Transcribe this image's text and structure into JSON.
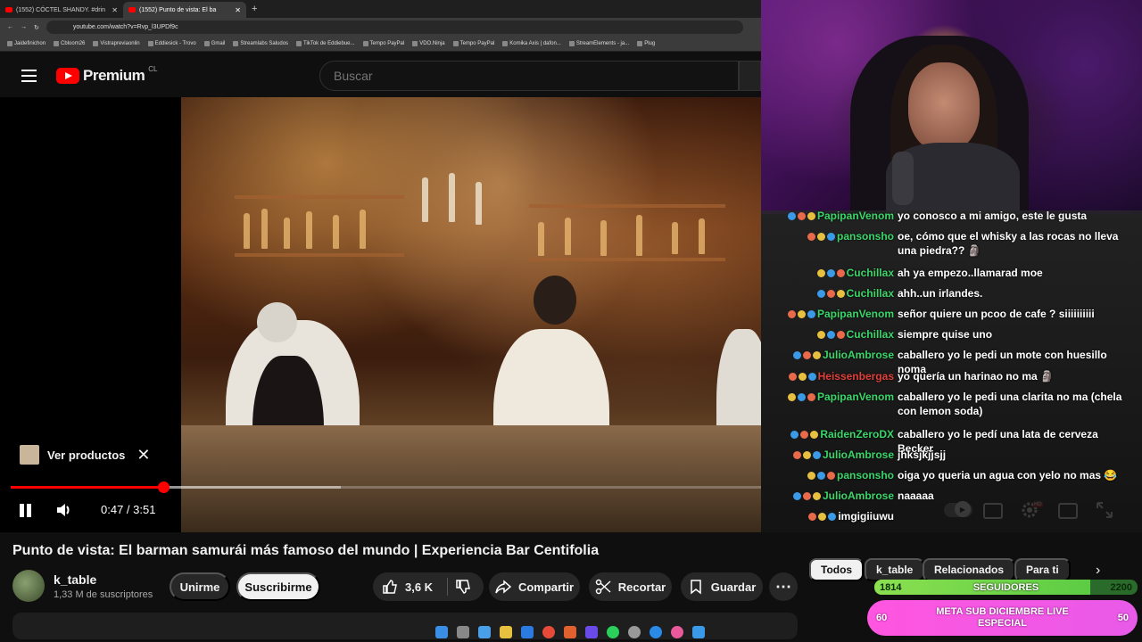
{
  "browser": {
    "tabs": [
      {
        "label": "(1552) CÓCTEL SHANDY. #drin"
      },
      {
        "label": "(1552) Punto de vista: El ba"
      }
    ],
    "url": "youtube.com/watch?v=Rvp_l3UPDf9c",
    "bookmarks": [
      "Jaidefinichon",
      "Cbloom26",
      "Vistrapreviaonlin",
      "Eddiesick - Trovo",
      "Gmail",
      "Streamlabs Saludos",
      "TikTok de Eddiebue...",
      "Tempo PayPal",
      "VDO.Ninja",
      "Tempo PayPal",
      "Komika Axis | dafon...",
      "StreamElements - ja...",
      "Plug"
    ]
  },
  "header": {
    "logo_text": "Premium",
    "country": "CL",
    "search_placeholder": "Buscar"
  },
  "player": {
    "ver_productos": "Ver productos",
    "time_current": "0:47",
    "time_total": "3:51",
    "time_display": "0:47 / 3:51",
    "progress_fraction": 0.203,
    "buffered_fraction": 0.44,
    "hd_badge": "HD"
  },
  "video": {
    "title": "Punto de vista: El barman samurái más famoso del mundo | Experiencia Bar Centifolia",
    "channel": "k_table",
    "subscribers": "1,33 M de suscriptores",
    "join_label": "Unirme",
    "subscribe_label": "Suscribirme",
    "likes": "3,6 K",
    "share_label": "Compartir",
    "clip_label": "Recortar",
    "save_label": "Guardar"
  },
  "chips": [
    "Todos",
    "k_table",
    "Relacionados",
    "Para ti"
  ],
  "chat": [
    {
      "name": "PapipanVenom",
      "color": "#3bd66a",
      "message": "yo conosco a mi amigo, este le gusta"
    },
    {
      "name": "pansonsho",
      "color": "#3bd66a",
      "message": "oe, cómo que el whisky a las rocas no lleva una piedra?? 🗿"
    },
    {
      "name": "Cuchillax",
      "color": "#3bd66a",
      "message": "ah ya empezo..llamarad moe"
    },
    {
      "name": "Cuchillax",
      "color": "#3bd66a",
      "message": "ahh..un irlandes."
    },
    {
      "name": "PapipanVenom",
      "color": "#3bd66a",
      "message": "señor quiere un pcoo de cafe ? siiiiiiiiii"
    },
    {
      "name": "Cuchillax",
      "color": "#3bd66a",
      "message": "siempre quise uno"
    },
    {
      "name": "JulioAmbrose",
      "color": "#3bd66a",
      "message": "caballero yo le pedi un mote con huesillo noma"
    },
    {
      "name": "Heissenbergas",
      "color": "#e0403a",
      "message": "yo quería un harinao no ma 🗿"
    },
    {
      "name": "PapipanVenom",
      "color": "#3bd66a",
      "message": "caballero yo le pedi una clarita no ma (chela con lemon soda)"
    },
    {
      "name": "RaidenZeroDX",
      "color": "#3bd66a",
      "message": "caballero yo le pedí una lata de cerveza Becker"
    },
    {
      "name": "JulioAmbrose",
      "color": "#3bd66a",
      "message": "jhksjkjjsjj"
    },
    {
      "name": "pansonsho",
      "color": "#3bd66a",
      "message": "oiga yo queria un agua con yelo no mas 😂"
    },
    {
      "name": "JulioAmbrose",
      "color": "#3bd66a",
      "message": "naaaaa"
    },
    {
      "name": "imgigiiuwu",
      "color": "#ffffff",
      "message": ""
    }
  ],
  "goals": {
    "followers_current": "1814",
    "followers_label": "SEGUIDORES",
    "followers_target": "2200",
    "followers_fraction": 0.82,
    "sub_current": "60",
    "sub_label": "META SUB DICIEMBRE LIVE ESPECIAL",
    "sub_target": "50"
  },
  "colors": {
    "accent": "#ff0000",
    "chat_name": "#3bd66a",
    "followers_bar": "#7dd84e",
    "sub_goal": "#f05ae6"
  }
}
